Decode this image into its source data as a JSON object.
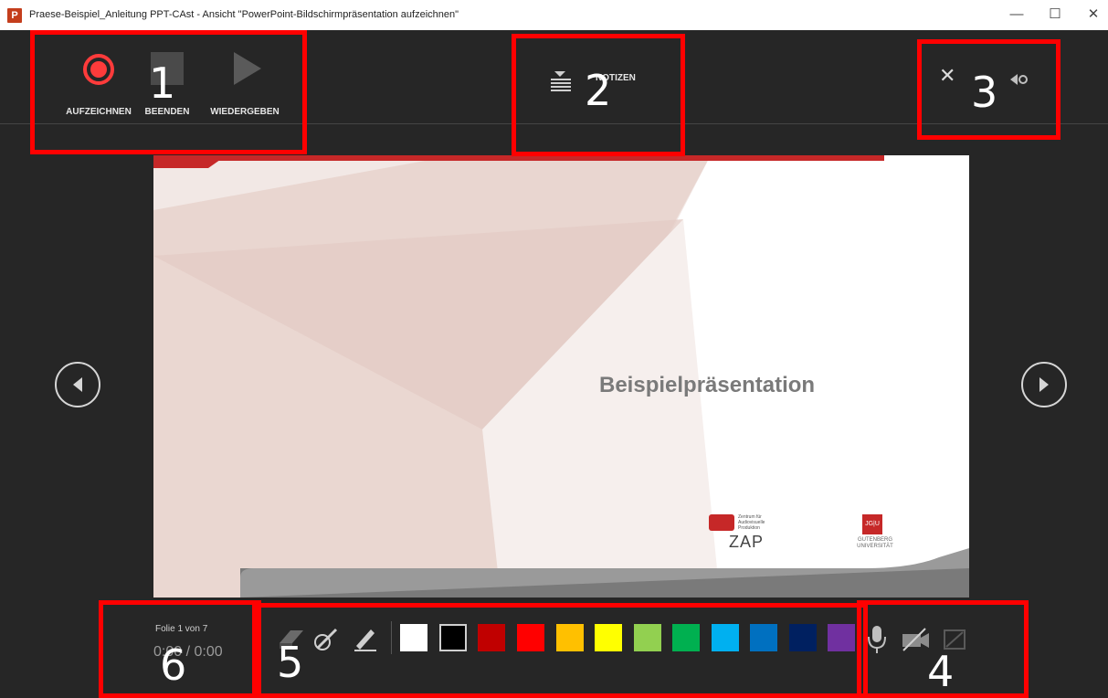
{
  "window": {
    "app_icon_letter": "P",
    "title": "Praese-Beispiel_Anleitung PPT-CAst  -  Ansicht \"PowerPoint-Bildschirmpräsentation aufzeichnen\"",
    "minimize_glyph": "—",
    "maximize_glyph": "☐",
    "close_glyph": "✕"
  },
  "toolbar": {
    "record_label": "AUFZEICHNEN",
    "stop_label": "BEENDEN",
    "play_label": "WIEDERGEBEN",
    "notes_label": "NOTIZEN",
    "close_glyph": "✕"
  },
  "slide": {
    "title": "Beispielpräsentation",
    "logo_zap_caption": "Zentrum für Audiovisuelle Produktion",
    "logo_zap_text": "ZAP",
    "logo_jgu_badge": "JG|U",
    "logo_jgu_text": "GUTENBERG UNIVERSITÄT"
  },
  "status": {
    "slide_counter": "Folie 1 von 7",
    "time": "0:00 / 0:00"
  },
  "pen_colors": [
    "#ffffff",
    "#000000",
    "#c00000",
    "#ff0000",
    "#ffc000",
    "#ffff00",
    "#92d050",
    "#00b050",
    "#00b0f0",
    "#0070c0",
    "#002060",
    "#7030a0"
  ],
  "annotations": [
    "1",
    "2",
    "3",
    "4",
    "5",
    "6"
  ]
}
